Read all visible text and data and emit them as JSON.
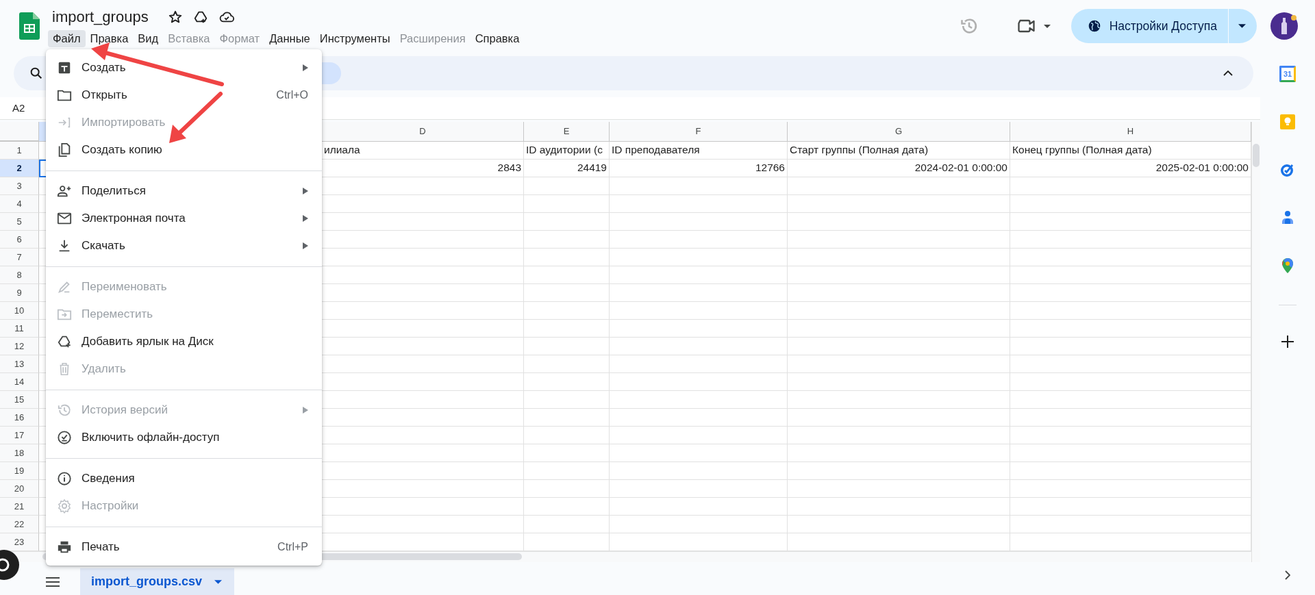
{
  "document": {
    "title": "import_groups"
  },
  "menu_bar": [
    {
      "label": "Файл",
      "selected": true,
      "disabled": false
    },
    {
      "label": "Правка",
      "selected": false,
      "disabled": false
    },
    {
      "label": "Вид",
      "selected": false,
      "disabled": false
    },
    {
      "label": "Вставка",
      "selected": false,
      "disabled": true
    },
    {
      "label": "Формат",
      "selected": false,
      "disabled": true
    },
    {
      "label": "Данные",
      "selected": false,
      "disabled": false
    },
    {
      "label": "Инструменты",
      "selected": false,
      "disabled": false
    },
    {
      "label": "Расширения",
      "selected": false,
      "disabled": true
    },
    {
      "label": "Справка",
      "selected": false,
      "disabled": false
    }
  ],
  "share_button": {
    "label": "Настройки Доступа"
  },
  "name_box": "A2",
  "grid": {
    "columns": [
      {
        "selected": true
      },
      {
        "letter": "D",
        "selected": false,
        "cells": [
          {
            "text": "илиала",
            "kind": "text"
          },
          {
            "text": "2843",
            "kind": "number"
          }
        ]
      },
      {
        "letter": "E",
        "selected": false,
        "cells": [
          {
            "text": "ID аудитории (с",
            "kind": "text"
          },
          {
            "text": "24419",
            "kind": "number"
          }
        ]
      },
      {
        "letter": "F",
        "selected": false,
        "cells": [
          {
            "text": "ID преподавателя",
            "kind": "text"
          },
          {
            "text": "12766",
            "kind": "number"
          }
        ]
      },
      {
        "letter": "G",
        "selected": false,
        "cells": [
          {
            "text": "Старт группы (Полная дата)",
            "kind": "text"
          },
          {
            "text": "2024-02-01 0:00:00",
            "kind": "number"
          }
        ]
      },
      {
        "letter": "H",
        "selected": false,
        "cells": [
          {
            "text": "Конец группы (Полная дата)",
            "kind": "text"
          },
          {
            "text": "2025-02-01 0:00:00",
            "kind": "number"
          }
        ]
      }
    ],
    "rows": [
      {
        "number": "1",
        "selected": false
      },
      {
        "number": "2",
        "selected": true
      },
      {
        "number": "3",
        "selected": false
      },
      {
        "number": "4",
        "selected": false
      },
      {
        "number": "5",
        "selected": false
      },
      {
        "number": "6",
        "selected": false
      },
      {
        "number": "7",
        "selected": false
      },
      {
        "number": "8",
        "selected": false
      },
      {
        "number": "9",
        "selected": false
      },
      {
        "number": "10",
        "selected": false
      },
      {
        "number": "11",
        "selected": false
      },
      {
        "number": "12",
        "selected": false
      },
      {
        "number": "13",
        "selected": false
      },
      {
        "number": "14",
        "selected": false
      },
      {
        "number": "15",
        "selected": false
      },
      {
        "number": "16",
        "selected": false
      },
      {
        "number": "17",
        "selected": false
      },
      {
        "number": "18",
        "selected": false
      },
      {
        "number": "19",
        "selected": false
      },
      {
        "number": "20",
        "selected": false
      },
      {
        "number": "21",
        "selected": false
      },
      {
        "number": "22",
        "selected": false
      },
      {
        "number": "23",
        "selected": false
      }
    ]
  },
  "file_menu": {
    "sections": [
      {
        "items": [
          {
            "label": "Создать",
            "submenu": true,
            "disabled": false
          },
          {
            "label": "Открыть",
            "shortcut": "Ctrl+O",
            "submenu": false,
            "disabled": false
          },
          {
            "label": "Импортировать",
            "submenu": false,
            "disabled": true
          },
          {
            "label": "Создать копию",
            "submenu": false,
            "disabled": false
          }
        ]
      },
      {
        "items": [
          {
            "label": "Поделиться",
            "submenu": true,
            "disabled": false
          },
          {
            "label": "Электронная почта",
            "submenu": true,
            "disabled": false
          },
          {
            "label": "Скачать",
            "submenu": true,
            "disabled": false
          }
        ]
      },
      {
        "items": [
          {
            "label": "Переименовать",
            "submenu": false,
            "disabled": true
          },
          {
            "label": "Переместить",
            "submenu": false,
            "disabled": true
          },
          {
            "label": "Добавить ярлык на Диск",
            "submenu": false,
            "disabled": false
          },
          {
            "label": "Удалить",
            "submenu": false,
            "disabled": true
          }
        ]
      },
      {
        "items": [
          {
            "label": "История версий",
            "submenu": true,
            "disabled": true
          },
          {
            "label": "Включить офлайн-доступ",
            "submenu": false,
            "disabled": false
          }
        ]
      },
      {
        "items": [
          {
            "label": "Сведения",
            "submenu": false,
            "disabled": false
          },
          {
            "label": "Настройки",
            "submenu": false,
            "disabled": true
          }
        ]
      },
      {
        "items": [
          {
            "label": "Печать",
            "shortcut": "Ctrl+P",
            "submenu": false,
            "disabled": false
          }
        ]
      }
    ]
  },
  "sheet_tabs": [
    {
      "label": "import_groups.csv",
      "selected": true
    }
  ],
  "side_panel": {
    "calendar_day": "31"
  }
}
